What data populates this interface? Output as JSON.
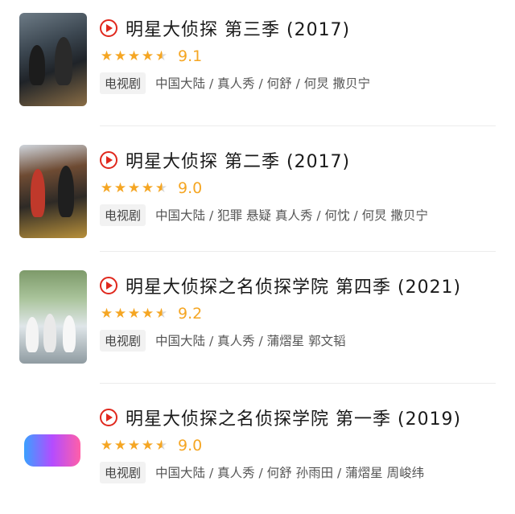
{
  "items": [
    {
      "title": "明星大侦探 第三季 (2017)",
      "score": "9.1",
      "stars": 4.5,
      "tag": "电视剧",
      "meta": "中国大陆 / 真人秀 / 何舒 / 何炅 撒贝宁"
    },
    {
      "title": "明星大侦探 第二季 (2017)",
      "score": "9.0",
      "stars": 4.5,
      "tag": "电视剧",
      "meta": "中国大陆 / 犯罪 悬疑 真人秀 / 何忱 / 何炅 撒贝宁"
    },
    {
      "title": "明星大侦探之名侦探学院 第四季 (2021)",
      "score": "9.2",
      "stars": 4.5,
      "tag": "电视剧",
      "meta": "中国大陆 / 真人秀 / 蒲熠星 郭文韬"
    },
    {
      "title": "明星大侦探之名侦探学院 第一季 (2019)",
      "score": "9.0",
      "stars": 4.5,
      "tag": "电视剧",
      "meta": "中国大陆 / 真人秀 / 何舒 孙雨田 / 蒲熠星 周峻纬"
    }
  ],
  "colors": {
    "accent": "#e0281d",
    "star": "#f5a623"
  }
}
